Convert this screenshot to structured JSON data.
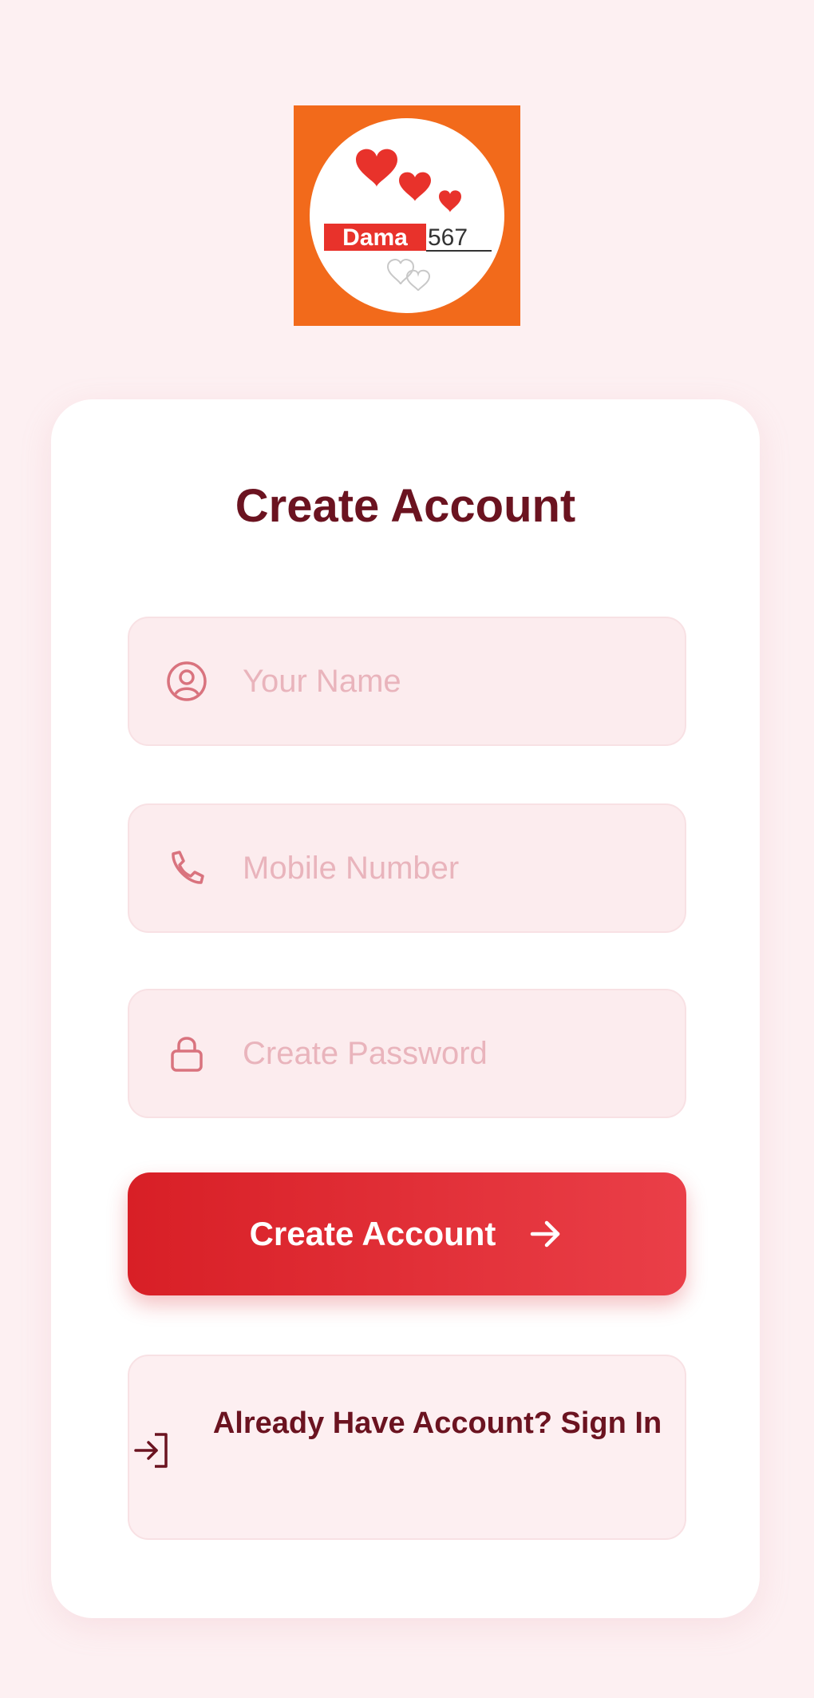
{
  "logo": {
    "brand_left": "Dama",
    "brand_right": "567"
  },
  "form": {
    "title": "Create Account",
    "name_placeholder": "Your Name",
    "mobile_placeholder": "Mobile Number",
    "password_placeholder": "Create Password",
    "submit_label": "Create Account",
    "signin_label": "Already Have Account? Sign In"
  },
  "icons": {
    "name": "user-circle-icon",
    "mobile": "phone-icon",
    "password": "lock-icon",
    "submit": "arrow-right-icon",
    "signin": "sign-in-icon"
  },
  "colors": {
    "page_background": "#fdf0f2",
    "logo_background": "#f26a1b",
    "heart": "#e8322b",
    "title": "#6b1320",
    "accent_start": "#d81f26",
    "accent_end": "#ea3f48",
    "field_background": "#fcecee",
    "placeholder": "#e9b4bc"
  }
}
